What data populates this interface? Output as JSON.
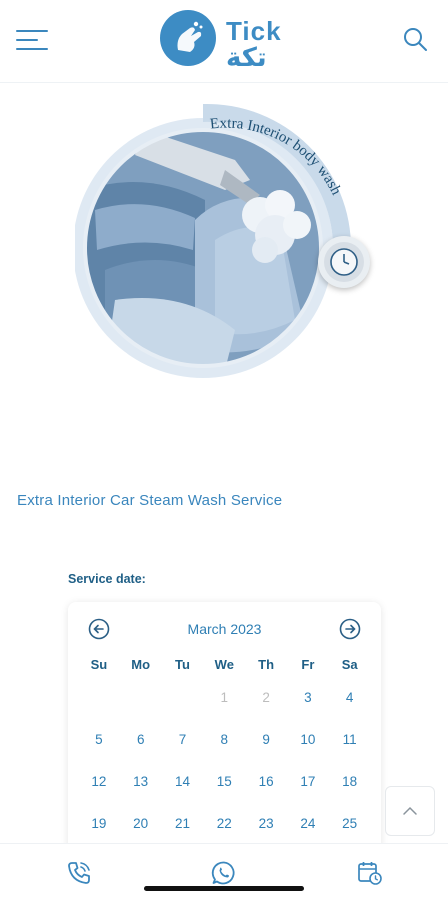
{
  "header": {
    "logo_text_en": "Tick",
    "logo_text_ar": "تكة",
    "menu_icon": "hamburger-icon",
    "search_icon": "search-icon"
  },
  "hero": {
    "banner_text": "Extra Interior body wash",
    "badge_icon": "clock-icon"
  },
  "service": {
    "title": "Extra Interior Car Steam Wash Service",
    "date_label": "Service date:"
  },
  "calendar": {
    "month": "March 2023",
    "weekdays": [
      "Su",
      "Mo",
      "Tu",
      "We",
      "Th",
      "Fr",
      "Sa"
    ],
    "weeks": [
      [
        "",
        "",
        "",
        "1",
        "2",
        "3",
        "4"
      ],
      [
        "5",
        "6",
        "7",
        "8",
        "9",
        "10",
        "11"
      ],
      [
        "12",
        "13",
        "14",
        "15",
        "16",
        "17",
        "18"
      ],
      [
        "19",
        "20",
        "21",
        "22",
        "23",
        "24",
        "25"
      ]
    ],
    "disabled_days": [
      "1",
      "2"
    ]
  },
  "colors": {
    "accent": "#3d8cc4",
    "dark_accent": "#1f5f86",
    "disabled": "#bdbdbd"
  },
  "bottom_bar": {
    "icons": [
      "phone-icon",
      "whatsapp-icon",
      "calendar-clock-icon"
    ]
  }
}
